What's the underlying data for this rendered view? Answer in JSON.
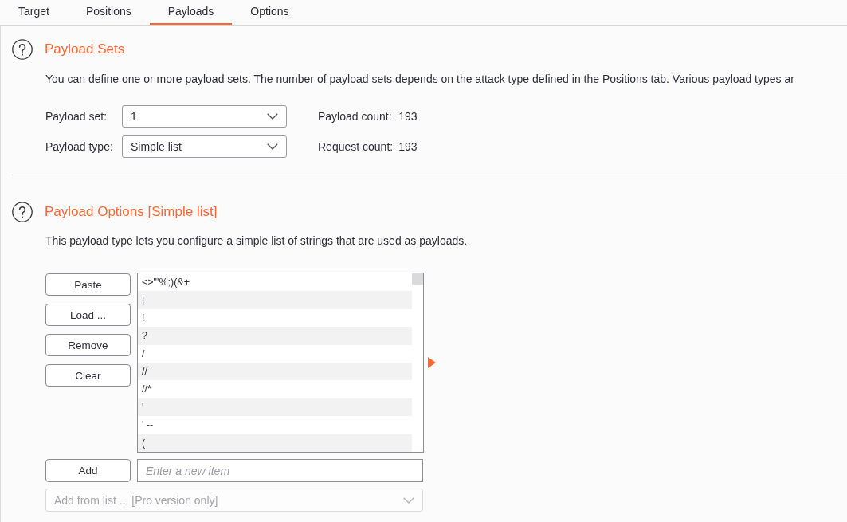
{
  "tabs": [
    {
      "label": "Target",
      "selected": false
    },
    {
      "label": "Positions",
      "selected": false
    },
    {
      "label": "Payloads",
      "selected": true
    },
    {
      "label": "Options",
      "selected": false
    }
  ],
  "payload_sets": {
    "title": "Payload Sets",
    "description": "You can define one or more payload sets. The number of payload sets depends on the attack type defined in the Positions tab. Various payload types ar",
    "settings": [
      {
        "label": "Payload set:",
        "value": "1",
        "count_label": "Payload count:",
        "count": "193"
      },
      {
        "label": "Payload type:",
        "value": "Simple list",
        "count_label": "Request count:",
        "count": "193"
      }
    ]
  },
  "payload_options": {
    "title": "Payload Options [Simple list]",
    "description": "This payload type lets you configure a simple list of strings that are used as payloads.",
    "buttons": [
      "Paste",
      "Load ...",
      "Remove",
      "Clear"
    ],
    "items": [
      "<>\"'%;)(&+",
      "|",
      "!",
      "?",
      "/",
      "//",
      "//*",
      "'",
      "' --",
      "("
    ],
    "add_button": "Add",
    "new_item": {
      "placeholder": "Enter a new item"
    },
    "add_from_list": {
      "value": "Add from list ... [Pro version only]",
      "disabled": true
    }
  }
}
